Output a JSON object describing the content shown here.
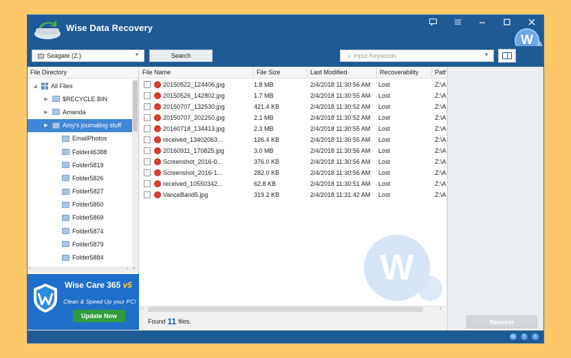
{
  "app": {
    "title": "Wise Data Recovery"
  },
  "toolbar": {
    "drive": "Seagate (Z:)",
    "search_label": "Search",
    "keyword_placeholder": "Input Keywords"
  },
  "tree": {
    "header": "File Directory",
    "items": [
      {
        "label": "All Files",
        "level": 0,
        "type": "all",
        "expander": "◢"
      },
      {
        "label": "$RECYCLE.BIN",
        "level": 1,
        "type": "folder",
        "expander": "▶"
      },
      {
        "label": "Amanda",
        "level": 1,
        "type": "folder",
        "expander": "▶"
      },
      {
        "label": "Amy's journaling stuff",
        "level": 1,
        "type": "folder",
        "expander": "▶",
        "selected": true
      },
      {
        "label": "EmailPhotos",
        "level": 2,
        "type": "folder",
        "expander": ""
      },
      {
        "label": "Folder46388",
        "level": 2,
        "type": "folder",
        "expander": ""
      },
      {
        "label": "Folder5819",
        "level": 2,
        "type": "folder",
        "expander": ""
      },
      {
        "label": "Folder5826",
        "level": 2,
        "type": "folder",
        "expander": ""
      },
      {
        "label": "Folder5827",
        "level": 2,
        "type": "folder",
        "expander": ""
      },
      {
        "label": "Folder5850",
        "level": 2,
        "type": "folder",
        "expander": ""
      },
      {
        "label": "Folder5869",
        "level": 2,
        "type": "folder",
        "expander": ""
      },
      {
        "label": "Folder5874",
        "level": 2,
        "type": "folder",
        "expander": ""
      },
      {
        "label": "Folder5879",
        "level": 2,
        "type": "folder",
        "expander": ""
      },
      {
        "label": "Folder5884",
        "level": 2,
        "type": "folder",
        "expander": ""
      }
    ]
  },
  "ad": {
    "title": "Wise Care 365",
    "version": "v5",
    "subtitle": "Clean & Speed Up your PC!",
    "button": "Update Now"
  },
  "files": {
    "columns": [
      "File Name",
      "File Size",
      "Last Modified",
      "Recoverability",
      "Path"
    ],
    "rows": [
      {
        "name": "20150522_124406.jpg",
        "size": "1.8 MB",
        "modified": "2/4/2018 11:30:56 AM",
        "recoverability": "Lost",
        "path": "Z:\\Amy's j..."
      },
      {
        "name": "20150526_142802.jpg",
        "size": "1.7 MB",
        "modified": "2/4/2018 11:30:55 AM",
        "recoverability": "Lost",
        "path": "Z:\\Amy's j..."
      },
      {
        "name": "20150707_132530.jpg",
        "size": "421.4 KB",
        "modified": "2/4/2018 11:30:52 AM",
        "recoverability": "Lost",
        "path": "Z:\\Amy's j..."
      },
      {
        "name": "20150707_202250.jpg",
        "size": "2.1 MB",
        "modified": "2/4/2018 11:30:52 AM",
        "recoverability": "Lost",
        "path": "Z:\\Amy's j..."
      },
      {
        "name": "20160718_134413.jpg",
        "size": "2.3 MB",
        "modified": "2/4/2018 11:30:55 AM",
        "recoverability": "Lost",
        "path": "Z:\\Amy's j..."
      },
      {
        "name": "received_13402063...",
        "size": "126.4 KB",
        "modified": "2/4/2018 11:30:55 AM",
        "recoverability": "Lost",
        "path": "Z:\\Amy's j..."
      },
      {
        "name": "20160911_170825.jpg",
        "size": "3.0 MB",
        "modified": "2/4/2018 11:30:56 AM",
        "recoverability": "Lost",
        "path": "Z:\\Amy's j..."
      },
      {
        "name": "Screenshot_2016-0...",
        "size": "376.0 KB",
        "modified": "2/4/2018 11:30:56 AM",
        "recoverability": "Lost",
        "path": "Z:\\Amy's j..."
      },
      {
        "name": "Screenshot_2016-1...",
        "size": "282.0 KB",
        "modified": "2/4/2018 11:30:56 AM",
        "recoverability": "Lost",
        "path": "Z:\\Amy's j..."
      },
      {
        "name": "received_10550342...",
        "size": "62.8 KB",
        "modified": "2/4/2018 11:30:51 AM",
        "recoverability": "Lost",
        "path": "Z:\\Amy's j..."
      },
      {
        "name": "VanceBand5.jpg",
        "size": "319.2 KB",
        "modified": "2/4/2018 11:31:42 AM",
        "recoverability": "Lost",
        "path": "Z:\\Amy's j..."
      }
    ]
  },
  "status": {
    "found_prefix": "Found",
    "found_count": "11",
    "found_suffix": "files."
  },
  "actions": {
    "recover": "Recover"
  },
  "colors": {
    "brand": "#1d5a96",
    "selection": "#3f86d6",
    "lost_dot": "#e03c2f",
    "ad_bg": "#1e6fc9"
  }
}
